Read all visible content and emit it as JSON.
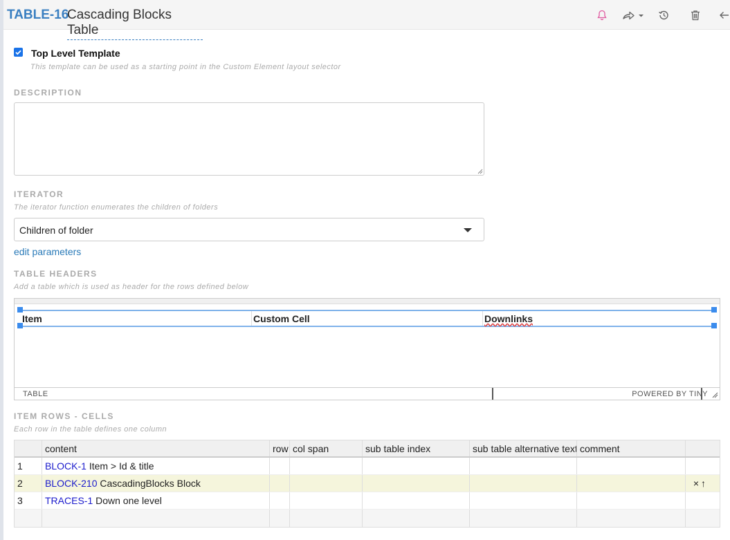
{
  "header": {
    "item_id": "TABLE-16",
    "title": "Cascading Blocks Table",
    "icons": [
      "bell-icon",
      "share-icon",
      "history-icon",
      "trash-icon",
      "arrow-left-icon"
    ]
  },
  "top_level": {
    "checked": true,
    "label": "Top Level Template",
    "hint": "This template can be used as a starting point in the Custom Element layout selector"
  },
  "description": {
    "label": "DESCRIPTION",
    "value": ""
  },
  "iterator": {
    "label": "ITERATOR",
    "hint": "The iterator function enumerates the children of folders",
    "selected": "Children of folder",
    "edit_link": "edit parameters"
  },
  "table_headers": {
    "label": "TABLE HEADERS",
    "hint": "Add a table which is used as header for the rows defined below",
    "columns": [
      "Item",
      "Custom Cell",
      "Downlinks"
    ],
    "status_left": "TABLE",
    "status_right": "POWERED BY TINY"
  },
  "item_rows": {
    "label": "ITEM ROWS - CELLS",
    "hint": "Each row in the table defines one column",
    "columns": [
      "",
      "content",
      "row",
      "col span",
      "sub table index",
      "sub table alternative text",
      "comment",
      ""
    ],
    "rows": [
      {
        "index": "1",
        "ref": "BLOCK-1",
        "text": "Item > Id & title"
      },
      {
        "index": "2",
        "ref": "BLOCK-210",
        "text": "CascadingBlocks Block"
      },
      {
        "index": "3",
        "ref": "TRACES-1",
        "text": "Down one level"
      }
    ],
    "row_actions": {
      "delete": "×",
      "move_up": "↑"
    }
  },
  "colors": {
    "accent": "#3a7fc1",
    "checkbox": "#1a73e8",
    "selected_row": "#f5f5dc",
    "reference_link": "#1a1acc",
    "bell": "#e05aa0"
  }
}
